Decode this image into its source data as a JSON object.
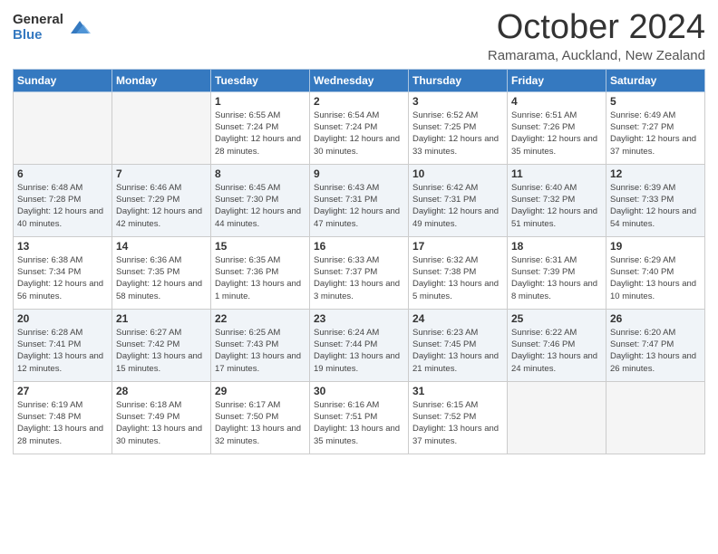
{
  "logo": {
    "general": "General",
    "blue": "Blue"
  },
  "title": {
    "month": "October 2024",
    "location": "Ramarama, Auckland, New Zealand"
  },
  "weekdays": [
    "Sunday",
    "Monday",
    "Tuesday",
    "Wednesday",
    "Thursday",
    "Friday",
    "Saturday"
  ],
  "weeks": [
    [
      {
        "day": "",
        "sunrise": "",
        "sunset": "",
        "daylight": ""
      },
      {
        "day": "",
        "sunrise": "",
        "sunset": "",
        "daylight": ""
      },
      {
        "day": "1",
        "sunrise": "Sunrise: 6:55 AM",
        "sunset": "Sunset: 7:24 PM",
        "daylight": "Daylight: 12 hours and 28 minutes."
      },
      {
        "day": "2",
        "sunrise": "Sunrise: 6:54 AM",
        "sunset": "Sunset: 7:24 PM",
        "daylight": "Daylight: 12 hours and 30 minutes."
      },
      {
        "day": "3",
        "sunrise": "Sunrise: 6:52 AM",
        "sunset": "Sunset: 7:25 PM",
        "daylight": "Daylight: 12 hours and 33 minutes."
      },
      {
        "day": "4",
        "sunrise": "Sunrise: 6:51 AM",
        "sunset": "Sunset: 7:26 PM",
        "daylight": "Daylight: 12 hours and 35 minutes."
      },
      {
        "day": "5",
        "sunrise": "Sunrise: 6:49 AM",
        "sunset": "Sunset: 7:27 PM",
        "daylight": "Daylight: 12 hours and 37 minutes."
      }
    ],
    [
      {
        "day": "6",
        "sunrise": "Sunrise: 6:48 AM",
        "sunset": "Sunset: 7:28 PM",
        "daylight": "Daylight: 12 hours and 40 minutes."
      },
      {
        "day": "7",
        "sunrise": "Sunrise: 6:46 AM",
        "sunset": "Sunset: 7:29 PM",
        "daylight": "Daylight: 12 hours and 42 minutes."
      },
      {
        "day": "8",
        "sunrise": "Sunrise: 6:45 AM",
        "sunset": "Sunset: 7:30 PM",
        "daylight": "Daylight: 12 hours and 44 minutes."
      },
      {
        "day": "9",
        "sunrise": "Sunrise: 6:43 AM",
        "sunset": "Sunset: 7:31 PM",
        "daylight": "Daylight: 12 hours and 47 minutes."
      },
      {
        "day": "10",
        "sunrise": "Sunrise: 6:42 AM",
        "sunset": "Sunset: 7:31 PM",
        "daylight": "Daylight: 12 hours and 49 minutes."
      },
      {
        "day": "11",
        "sunrise": "Sunrise: 6:40 AM",
        "sunset": "Sunset: 7:32 PM",
        "daylight": "Daylight: 12 hours and 51 minutes."
      },
      {
        "day": "12",
        "sunrise": "Sunrise: 6:39 AM",
        "sunset": "Sunset: 7:33 PM",
        "daylight": "Daylight: 12 hours and 54 minutes."
      }
    ],
    [
      {
        "day": "13",
        "sunrise": "Sunrise: 6:38 AM",
        "sunset": "Sunset: 7:34 PM",
        "daylight": "Daylight: 12 hours and 56 minutes."
      },
      {
        "day": "14",
        "sunrise": "Sunrise: 6:36 AM",
        "sunset": "Sunset: 7:35 PM",
        "daylight": "Daylight: 12 hours and 58 minutes."
      },
      {
        "day": "15",
        "sunrise": "Sunrise: 6:35 AM",
        "sunset": "Sunset: 7:36 PM",
        "daylight": "Daylight: 13 hours and 1 minute."
      },
      {
        "day": "16",
        "sunrise": "Sunrise: 6:33 AM",
        "sunset": "Sunset: 7:37 PM",
        "daylight": "Daylight: 13 hours and 3 minutes."
      },
      {
        "day": "17",
        "sunrise": "Sunrise: 6:32 AM",
        "sunset": "Sunset: 7:38 PM",
        "daylight": "Daylight: 13 hours and 5 minutes."
      },
      {
        "day": "18",
        "sunrise": "Sunrise: 6:31 AM",
        "sunset": "Sunset: 7:39 PM",
        "daylight": "Daylight: 13 hours and 8 minutes."
      },
      {
        "day": "19",
        "sunrise": "Sunrise: 6:29 AM",
        "sunset": "Sunset: 7:40 PM",
        "daylight": "Daylight: 13 hours and 10 minutes."
      }
    ],
    [
      {
        "day": "20",
        "sunrise": "Sunrise: 6:28 AM",
        "sunset": "Sunset: 7:41 PM",
        "daylight": "Daylight: 13 hours and 12 minutes."
      },
      {
        "day": "21",
        "sunrise": "Sunrise: 6:27 AM",
        "sunset": "Sunset: 7:42 PM",
        "daylight": "Daylight: 13 hours and 15 minutes."
      },
      {
        "day": "22",
        "sunrise": "Sunrise: 6:25 AM",
        "sunset": "Sunset: 7:43 PM",
        "daylight": "Daylight: 13 hours and 17 minutes."
      },
      {
        "day": "23",
        "sunrise": "Sunrise: 6:24 AM",
        "sunset": "Sunset: 7:44 PM",
        "daylight": "Daylight: 13 hours and 19 minutes."
      },
      {
        "day": "24",
        "sunrise": "Sunrise: 6:23 AM",
        "sunset": "Sunset: 7:45 PM",
        "daylight": "Daylight: 13 hours and 21 minutes."
      },
      {
        "day": "25",
        "sunrise": "Sunrise: 6:22 AM",
        "sunset": "Sunset: 7:46 PM",
        "daylight": "Daylight: 13 hours and 24 minutes."
      },
      {
        "day": "26",
        "sunrise": "Sunrise: 6:20 AM",
        "sunset": "Sunset: 7:47 PM",
        "daylight": "Daylight: 13 hours and 26 minutes."
      }
    ],
    [
      {
        "day": "27",
        "sunrise": "Sunrise: 6:19 AM",
        "sunset": "Sunset: 7:48 PM",
        "daylight": "Daylight: 13 hours and 28 minutes."
      },
      {
        "day": "28",
        "sunrise": "Sunrise: 6:18 AM",
        "sunset": "Sunset: 7:49 PM",
        "daylight": "Daylight: 13 hours and 30 minutes."
      },
      {
        "day": "29",
        "sunrise": "Sunrise: 6:17 AM",
        "sunset": "Sunset: 7:50 PM",
        "daylight": "Daylight: 13 hours and 32 minutes."
      },
      {
        "day": "30",
        "sunrise": "Sunrise: 6:16 AM",
        "sunset": "Sunset: 7:51 PM",
        "daylight": "Daylight: 13 hours and 35 minutes."
      },
      {
        "day": "31",
        "sunrise": "Sunrise: 6:15 AM",
        "sunset": "Sunset: 7:52 PM",
        "daylight": "Daylight: 13 hours and 37 minutes."
      },
      {
        "day": "",
        "sunrise": "",
        "sunset": "",
        "daylight": ""
      },
      {
        "day": "",
        "sunrise": "",
        "sunset": "",
        "daylight": ""
      }
    ]
  ],
  "shaded_rows": [
    1,
    3
  ]
}
